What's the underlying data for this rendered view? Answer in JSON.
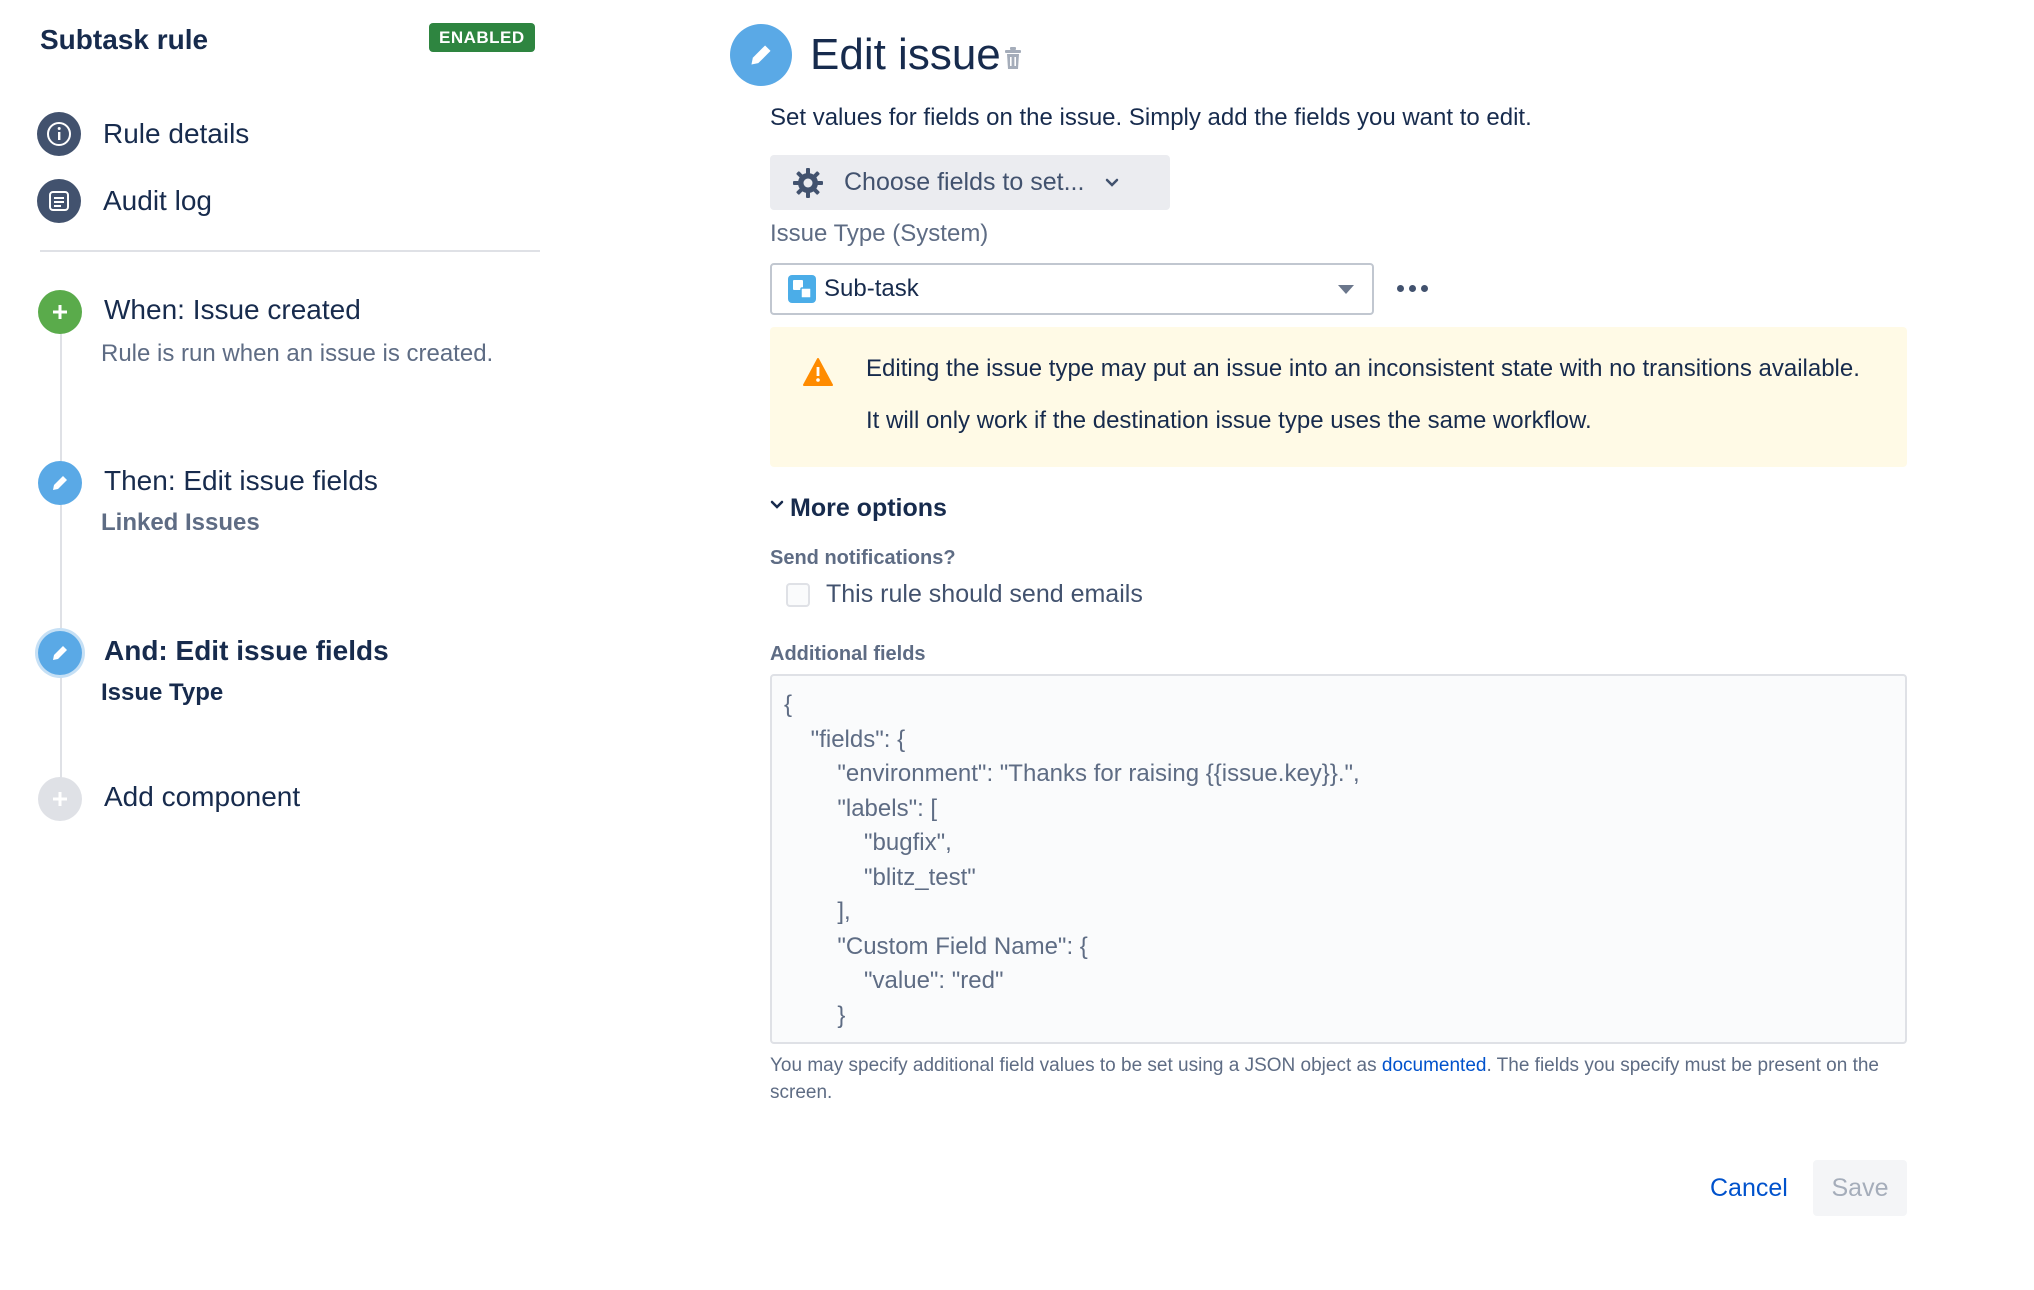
{
  "sidebar": {
    "rule_title": "Subtask rule",
    "status_badge": "ENABLED",
    "nav": [
      {
        "label": "Rule details",
        "icon": "info-icon"
      },
      {
        "label": "Audit log",
        "icon": "list-icon"
      }
    ],
    "steps": [
      {
        "title": "When: Issue created",
        "subtitle": "Rule is run when an issue is created.",
        "icon": "plus-icon",
        "color": "#5aab4b",
        "active": false
      },
      {
        "title": "Then: Edit issue fields",
        "subtitle": "Linked Issues",
        "icon": "pencil-icon",
        "color": "#5aa9e6",
        "active": false
      },
      {
        "title": "And: Edit issue fields",
        "subtitle": "Issue Type",
        "icon": "pencil-icon",
        "color": "#5aa9e6",
        "active": true
      },
      {
        "title": "Add component",
        "subtitle": "",
        "icon": "plus-icon",
        "color": "#c1c7d0",
        "active": false
      }
    ]
  },
  "main": {
    "title": "Edit issue",
    "description": "Set values for fields on the issue. Simply add the fields you want to edit.",
    "choose_fields_label": "Choose fields to set...",
    "issue_type_label": "Issue Type (System)",
    "issue_type_value": "Sub-task",
    "warning": {
      "line1": "Editing the issue type may put an issue into an inconsistent state with no transitions available.",
      "line2": "It will only work if the destination issue type uses the same workflow."
    },
    "more_options_label": "More options",
    "send_notifications_label": "Send notifications?",
    "send_emails_checkbox_label": "This rule should send emails",
    "send_emails_checked": false,
    "additional_fields_label": "Additional fields",
    "additional_fields_lines": [
      "{",
      "    \"fields\": {",
      "        \"environment\": \"Thanks for raising {{issue.key}}.\",",
      "        \"labels\": [",
      "            \"bugfix\",",
      "            \"blitz_test\"",
      "        ],",
      "        \"Custom Field Name\": {",
      "            \"value\": \"red\"",
      "        }"
    ],
    "helper_text_before": "You may specify additional field values to be set using a JSON object as ",
    "helper_link": "documented",
    "helper_text_after": ". The fields you specify must be present on the screen.",
    "cancel_label": "Cancel",
    "save_label": "Save"
  },
  "colors": {
    "accent": "#0052cc",
    "badge": "#2e8540",
    "warning_bg": "#fffae6",
    "warning_icon": "#ff8b00"
  }
}
